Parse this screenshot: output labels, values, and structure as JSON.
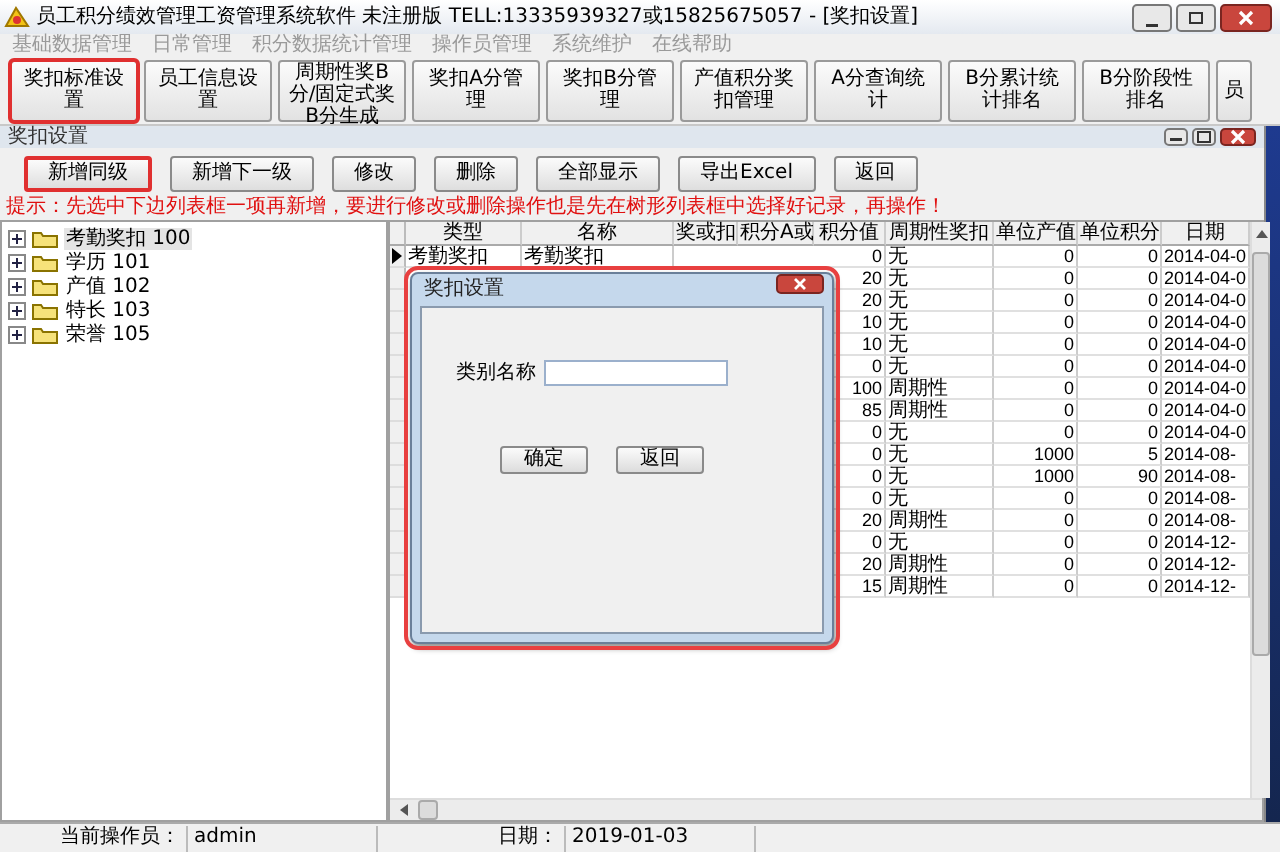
{
  "window": {
    "title": "员工积分绩效管理工资管理系统软件 未注册版 TELL:13335939327或15825675057 - [奖扣设置]"
  },
  "menu": [
    {
      "label": "基础数据管理",
      "disabled": true
    },
    {
      "label": "日常管理",
      "disabled": true
    },
    {
      "label": "积分数据统计管理",
      "disabled": true
    },
    {
      "label": "操作员管理",
      "disabled": true
    },
    {
      "label": "系统维护",
      "disabled": true
    },
    {
      "label": "在线帮助",
      "disabled": true
    }
  ],
  "toolbar": [
    {
      "label": "奖扣标准设置",
      "highlighted": true
    },
    {
      "label": "员工信息设置",
      "highlighted": false
    },
    {
      "label": "周期性奖B分/固定式奖B分生成",
      "highlighted": false
    },
    {
      "label": "奖扣A分管理",
      "highlighted": false
    },
    {
      "label": "奖扣B分管理",
      "highlighted": false
    },
    {
      "label": "产值积分奖扣管理",
      "highlighted": false
    },
    {
      "label": "A分查询统计",
      "highlighted": false
    },
    {
      "label": "B分累计统计排名",
      "highlighted": false
    },
    {
      "label": "B分阶段性排名",
      "highlighted": false
    },
    {
      "label": "员",
      "highlighted": false
    }
  ],
  "child_window": {
    "title": "奖扣设置"
  },
  "actions": [
    {
      "label": "新增同级",
      "highlighted": true
    },
    {
      "label": "新增下一级",
      "highlighted": false
    },
    {
      "label": "修改",
      "highlighted": false
    },
    {
      "label": "删除",
      "highlighted": false
    },
    {
      "label": "全部显示",
      "highlighted": false
    },
    {
      "label": "导出Excel",
      "highlighted": false
    },
    {
      "label": "返回",
      "highlighted": false
    }
  ],
  "hint": "提示：先选中下边列表框一项再新增，要进行修改或删除操作也是先在树形列表框中选择好记录，再操作！",
  "tree": [
    {
      "label": "考勤奖扣 100",
      "selected": true,
      "expanded": false
    },
    {
      "label": "学历 101",
      "selected": false,
      "expanded": false
    },
    {
      "label": "产值 102",
      "selected": false,
      "expanded": false
    },
    {
      "label": "特长 103",
      "selected": false,
      "expanded": false
    },
    {
      "label": "荣誉 105",
      "selected": false,
      "expanded": false
    }
  ],
  "table": {
    "columns": [
      {
        "label": "类型",
        "kind": "text"
      },
      {
        "label": "名称",
        "kind": "text"
      },
      {
        "label": "奖或扣",
        "kind": "text"
      },
      {
        "label": "积分A或",
        "kind": "text"
      },
      {
        "label": "积分值",
        "kind": "number"
      },
      {
        "label": "周期性奖扣",
        "kind": "text"
      },
      {
        "label": "单位产值",
        "kind": "number"
      },
      {
        "label": "单位积分",
        "kind": "number"
      },
      {
        "label": "日期",
        "kind": "text"
      }
    ],
    "rows": [
      {
        "selected": true,
        "cells": [
          "考勤奖扣",
          "考勤奖扣",
          null,
          null,
          "0",
          "无",
          "0",
          "0",
          "2014-04-0"
        ]
      },
      {
        "selected": false,
        "cells": [
          null,
          null,
          null,
          null,
          "20",
          "无",
          "0",
          "0",
          "2014-04-0"
        ]
      },
      {
        "selected": false,
        "cells": [
          null,
          null,
          null,
          null,
          "20",
          "无",
          "0",
          "0",
          "2014-04-0"
        ]
      },
      {
        "selected": false,
        "cells": [
          null,
          null,
          null,
          null,
          "10",
          "无",
          "0",
          "0",
          "2014-04-0"
        ]
      },
      {
        "selected": false,
        "cells": [
          null,
          null,
          null,
          null,
          "10",
          "无",
          "0",
          "0",
          "2014-04-0"
        ]
      },
      {
        "selected": false,
        "cells": [
          null,
          null,
          null,
          null,
          "0",
          "无",
          "0",
          "0",
          "2014-04-0"
        ]
      },
      {
        "selected": false,
        "cells": [
          null,
          null,
          null,
          null,
          "100",
          "周期性",
          "0",
          "0",
          "2014-04-0"
        ]
      },
      {
        "selected": false,
        "cells": [
          null,
          null,
          null,
          null,
          "85",
          "周期性",
          "0",
          "0",
          "2014-04-0"
        ]
      },
      {
        "selected": false,
        "cells": [
          null,
          null,
          null,
          null,
          "0",
          "无",
          "0",
          "0",
          "2014-04-0"
        ]
      },
      {
        "selected": false,
        "cells": [
          null,
          null,
          null,
          null,
          "0",
          "无",
          "1000",
          "5",
          "2014-08-"
        ]
      },
      {
        "selected": false,
        "cells": [
          null,
          null,
          null,
          null,
          "0",
          "无",
          "1000",
          "90",
          "2014-08-"
        ]
      },
      {
        "selected": false,
        "cells": [
          null,
          null,
          null,
          null,
          "0",
          "无",
          "0",
          "0",
          "2014-08-"
        ]
      },
      {
        "selected": false,
        "cells": [
          null,
          null,
          null,
          null,
          "20",
          "周期性",
          "0",
          "0",
          "2014-08-"
        ]
      },
      {
        "selected": false,
        "cells": [
          null,
          null,
          null,
          null,
          "0",
          "无",
          "0",
          "0",
          "2014-12-"
        ]
      },
      {
        "selected": false,
        "cells": [
          null,
          null,
          null,
          null,
          "20",
          "周期性",
          "0",
          "0",
          "2014-12-"
        ]
      },
      {
        "selected": false,
        "cells": [
          null,
          null,
          null,
          null,
          "15",
          "周期性",
          "0",
          "0",
          "2014-12-"
        ]
      }
    ]
  },
  "dialog": {
    "title": "奖扣设置",
    "highlighted": true,
    "field": {
      "label": "类别名称"
    },
    "buttons": [
      "确定",
      "返回"
    ]
  },
  "status_bar": [
    {
      "label": "当前操作员：",
      "value": "admin"
    },
    {
      "label": "日期：",
      "value": "2019-01-03"
    }
  ]
}
